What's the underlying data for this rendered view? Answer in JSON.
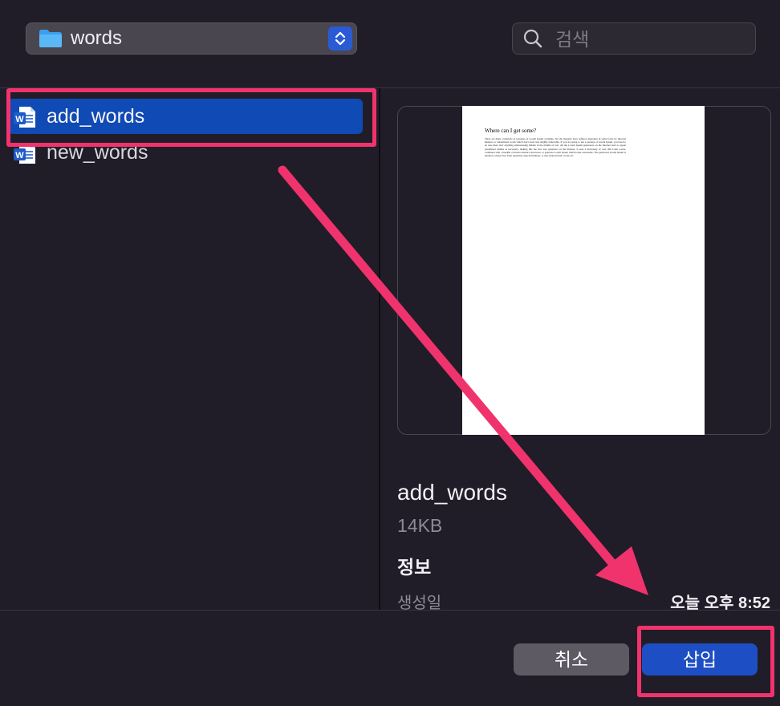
{
  "toolbar": {
    "location_label": "words",
    "search_placeholder": "검색"
  },
  "files": [
    {
      "name": "add_words",
      "selected": true
    },
    {
      "name": "new_words",
      "selected": false
    }
  ],
  "preview": {
    "doc_heading": "Where can I get some?",
    "doc_body": "There are many variations of passages of Lorem Ipsum available, but the majority have suffered alteration in some form, by injected humour, or randomised words which don't look even slightly believable. If you are going to use a passage of Lorem Ipsum, you need to be sure there isn't anything embarrassing hidden in the middle of text. All the Lorem Ipsum generators on the Internet tend to repeat predefined chunks as necessary, making this the first true generator on the Internet. It uses a dictionary of over 200 Latin words, combined with a handful of model sentence structures, to generate Lorem Ipsum which looks reasonable. The generated Lorem Ipsum is therefore always free from repetition, injected humour, or non-characteristic words etc."
  },
  "info": {
    "file_name": "add_words",
    "file_size": "14KB",
    "heading": "정보",
    "created_label": "생성일",
    "created_value": "오늘 오후 8:52"
  },
  "buttons": {
    "cancel_label": "취소",
    "insert_label": "삽입"
  },
  "colors": {
    "background": "#211d28",
    "selection": "#0f4ab5",
    "primary_button": "#1d4ec4",
    "annotation": "#f0336d"
  }
}
